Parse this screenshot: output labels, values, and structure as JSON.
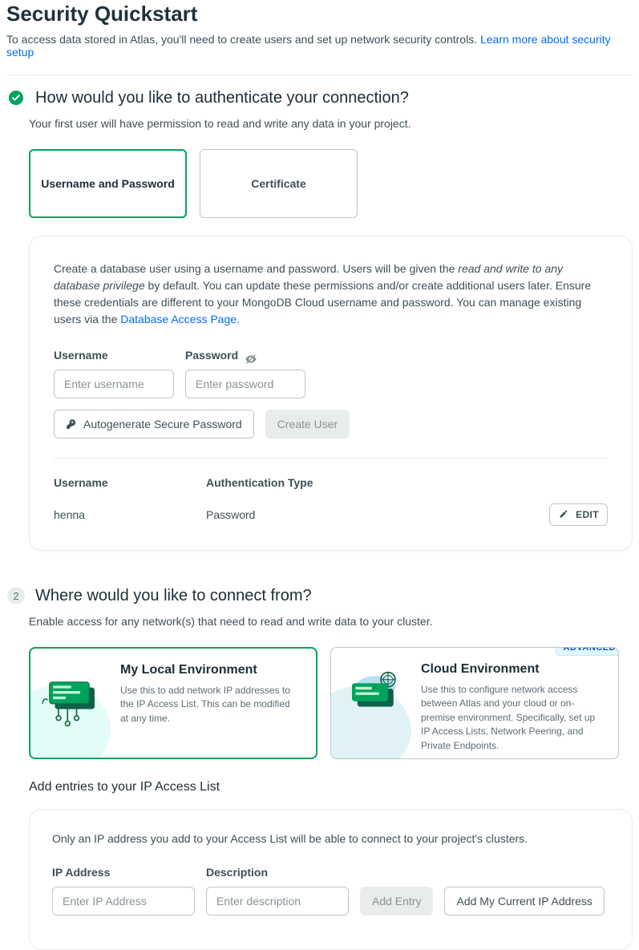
{
  "page": {
    "title": "Security Quickstart",
    "intro": "To access data stored in Atlas, you'll need to create users and set up network security controls. ",
    "intro_link": "Learn more about security setup"
  },
  "step1": {
    "title": "How would you like to authenticate your connection?",
    "subtitle": "Your first user will have permission to read and write any data in your project.",
    "tabs": {
      "userpass": "Username and Password",
      "certificate": "Certificate"
    },
    "desc_part1": "Create a database user using a username and password. Users will be given the ",
    "desc_italic": "read and write to any database privilege",
    "desc_part2": " by default. You can update these permissions and/or create additional users later. Ensure these credentials are different to your MongoDB Cloud username and password. You can manage existing users via the ",
    "desc_link": "Database Access Page.",
    "username_label": "Username",
    "password_label": "Password",
    "username_placeholder": "Enter username",
    "password_placeholder": "Enter password",
    "autogen_btn": "Autogenerate Secure Password",
    "create_user_btn": "Create User",
    "table": {
      "col_username": "Username",
      "col_authtype": "Authentication Type",
      "row": {
        "username": "henna",
        "authtype": "Password",
        "edit": "EDIT"
      }
    }
  },
  "step2": {
    "number": "2",
    "title": "Where would you like to connect from?",
    "subtitle": "Enable access for any network(s) that need to read and write data to your cluster.",
    "env_local": {
      "title": "My Local Environment",
      "desc": "Use this to add network IP addresses to the IP Access List. This can be modified at any time."
    },
    "env_cloud": {
      "title": "Cloud Environment",
      "badge": "ADVANCED",
      "desc": "Use this to configure network access between Atlas and your cloud or on-premise environment. Specifically, set up IP Access Lists, Network Peering, and Private Endpoints."
    },
    "iplist_title": "Add entries to your IP Access List",
    "iplist_desc": "Only an IP address you add to your Access List will be able to connect to your project's clusters.",
    "ip_label": "IP Address",
    "desc_label": "Description",
    "ip_placeholder": "Enter IP Address",
    "desc_placeholder": "Enter description",
    "add_entry_btn": "Add Entry",
    "add_current_btn": "Add My Current IP Address"
  }
}
